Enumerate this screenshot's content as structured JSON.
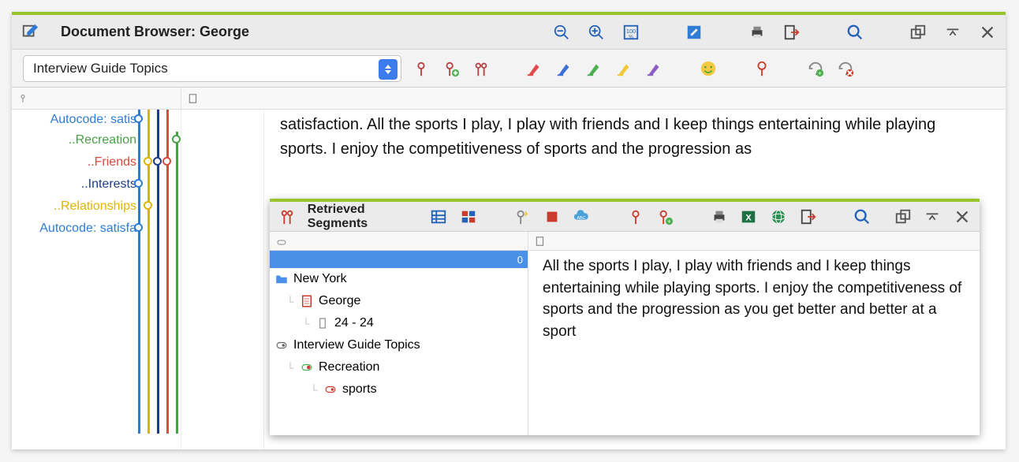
{
  "docBrowser": {
    "title": "Document Browser: George",
    "topicSelect": "Interview Guide Topics",
    "codes": [
      {
        "label": "Autocode: satis",
        "color": "#2e7cd6",
        "short": true
      },
      {
        "label": "..Recreation",
        "color": "#49a047"
      },
      {
        "label": "..Friends",
        "color": "#d94a3f"
      },
      {
        "label": "..Interests",
        "color": "#1d3d8a"
      },
      {
        "label": "..Relationships",
        "color": "#e0b300"
      },
      {
        "label": "Autocode: satisfa",
        "color": "#2e7cd6",
        "short": true
      }
    ],
    "text": "satisfaction. All the sports I play, I play with friends and I keep things entertaining while playing sports. I enjoy the competitiveness of sports and the progression as"
  },
  "retrieved": {
    "title": "Retrieved Segments",
    "selected_count": "0",
    "tree": {
      "folder": "New York",
      "doc": "George",
      "range": "24 - 24",
      "topic": "Interview Guide Topics",
      "code": "Recreation",
      "subcode": "sports"
    },
    "text": "All the sports I play, I play with friends and I keep things entertaining while playing sports. I enjoy the competitiveness of sports and the progression as you get better and better at a sport"
  },
  "palette": {
    "highlighters": [
      "#e24a4a",
      "#3b6fd9",
      "#4caf50",
      "#f2c838",
      "#8a5cc4"
    ]
  }
}
